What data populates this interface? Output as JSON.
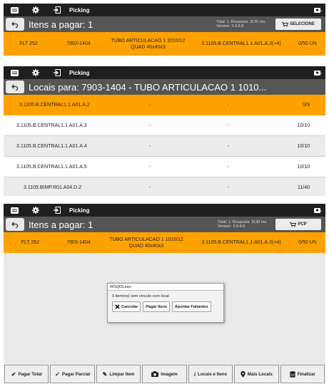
{
  "app": {
    "title": "Picking"
  },
  "panel1": {
    "header_title": "Itens a pagar: 1",
    "info_line1": "Total: 1. Resposta: 3130 ms.",
    "info_line2": "Version: 3.9.8.8",
    "button_label": "SELECIONE",
    "item": {
      "code": "FLT 252",
      "ref": "7903-1404",
      "desc_line1": "TUBO ARTICULACAO 1 1010/12",
      "desc_line2": "QUAD 40x40x3",
      "location": "3.1105.B.CENTRAL1.1.A01.A.2(+4)",
      "qty": "0/50 UN"
    }
  },
  "panel2": {
    "header_title": "Locais para: 7903-1404 - TUBO ARTICULACAO 1 1010...",
    "rows": [
      {
        "location": "3.1105.B.CENTRAL1.1.A01.A.2",
        "d1": "-",
        "d2": "-",
        "qty": "0/9"
      },
      {
        "location": "3.1105.B.CENTRAL1.1.A01.A.3",
        "d1": "-",
        "d2": "-",
        "qty": "10/10"
      },
      {
        "location": "3.1105.B.CENTRAL1.1.A01.A.4",
        "d1": "-",
        "d2": "-",
        "qty": "10/10"
      },
      {
        "location": "3.1105.B.CENTRAL1.1.A01.A.5",
        "d1": "-",
        "d2": "-",
        "qty": "10/10"
      },
      {
        "location": "3.1105.BIMP.R01.A04.D.2",
        "d1": "-",
        "d2": "-",
        "qty": "11/40"
      }
    ]
  },
  "panel3": {
    "header_title": "Itens a pagar: 1",
    "info_line1": "Total: 1. Resposta: 3130 ms.",
    "info_line2": "Version: 3.9.8.8",
    "button_label": "PCP",
    "item": {
      "code": "FLT 252",
      "ref": "7903-1404",
      "desc_line1": "TUBO ARTICULACAO 1 1010/12",
      "desc_line2": "QUAD 40x40x3",
      "location": "3.1105.B.CENTRAL1.1.A01.A.2(+4)",
      "qty": "0/50 UN"
    },
    "dialog": {
      "title": "WSQOLean",
      "message": "9 item(ns) sem vinculo com local",
      "btn_cancel": "Cancelar",
      "btn_pay": "Pagar Itens",
      "btn_point": "Apontar Faltantes"
    }
  },
  "bottom_bar": {
    "pagar_total": "Pagar Total",
    "pagar_parcial": "Pagar Parcial",
    "limpar_item": "Limpar Item",
    "imagem": "Imagem",
    "locais_itens": "Locais e Itens",
    "mais_locais": "Mais Locais",
    "finalizar": "Finalizar"
  },
  "colors": {
    "accent": "#ffa200",
    "topbar": "#1f1f1f",
    "headerbar": "#555555"
  }
}
